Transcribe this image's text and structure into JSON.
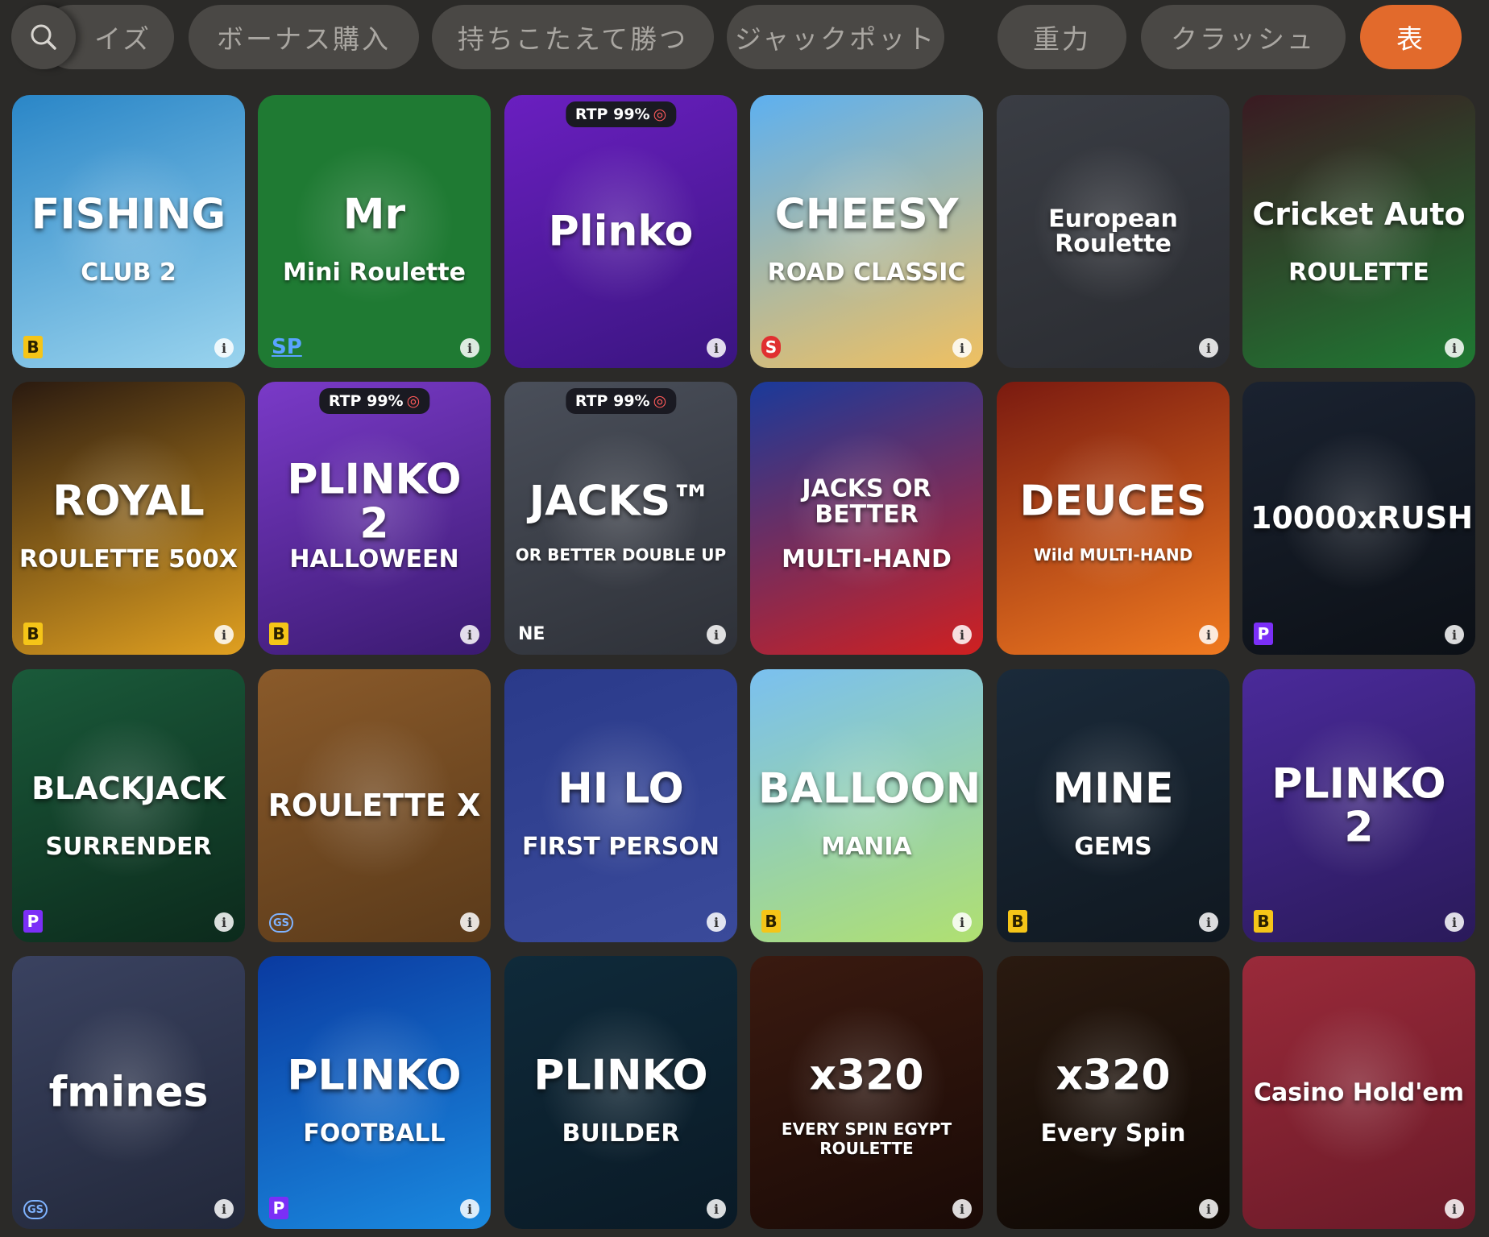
{
  "filters": {
    "search_icon": "search-icon",
    "chips": [
      {
        "label": "イズ",
        "active": false
      },
      {
        "label": "ボーナス購入",
        "active": false
      },
      {
        "label": "持ちこたえて勝つ",
        "active": false
      },
      {
        "label": "ジャックポット",
        "active": false
      },
      {
        "label": "重力",
        "active": false
      },
      {
        "label": "クラッシュ",
        "active": false
      },
      {
        "label": "表",
        "active": true
      }
    ]
  },
  "games": [
    {
      "title": "FISHING",
      "subtitle": "CLUB 2",
      "provider": "B",
      "rtp": "",
      "bg": "#2a86c7",
      "bg2": "#9ad4ee"
    },
    {
      "title": "Mr",
      "subtitle": "Mini Roulette",
      "provider": "SP",
      "rtp": "",
      "bg": "#1f7a33",
      "bg2": "#1f7a33"
    },
    {
      "title": "Plinko",
      "subtitle": "",
      "provider": "",
      "rtp": "RTP 99%",
      "bg": "#6a1fc0",
      "bg2": "#3a1580"
    },
    {
      "title": "CHEESY",
      "subtitle": "ROAD CLASSIC",
      "provider": "S",
      "rtp": "",
      "bg": "#5db0f0",
      "bg2": "#f0c060"
    },
    {
      "title": "European Roulette",
      "subtitle": "",
      "provider": "",
      "rtp": "",
      "bg": "#3a3d44",
      "bg2": "#2a2c31"
    },
    {
      "title": "Cricket Auto",
      "subtitle": "ROULETTE",
      "provider": "",
      "rtp": "",
      "bg": "#3a1a22",
      "bg2": "#1f7a33"
    },
    {
      "title": "ROYAL",
      "subtitle": "ROULETTE 500X",
      "provider": "B",
      "rtp": "",
      "bg": "#2a1a10",
      "bg2": "#e0a020"
    },
    {
      "title": "PLINKO 2",
      "subtitle": "HALLOWEEN",
      "provider": "B",
      "rtp": "RTP 99%",
      "bg": "#7a3ac8",
      "bg2": "#3a1a70"
    },
    {
      "title": "JACKS™",
      "subtitle": "OR BETTER DOUBLE UP",
      "provider": "NE",
      "rtp": "RTP 99%",
      "bg": "#4a4f5a",
      "bg2": "#2e3138"
    },
    {
      "title": "JACKS OR BETTER",
      "subtitle": "MULTI-HAND",
      "provider": "",
      "rtp": "",
      "bg": "#1a3a9a",
      "bg2": "#d02020"
    },
    {
      "title": "DEUCES",
      "subtitle": "Wild MULTI-HAND",
      "provider": "",
      "rtp": "",
      "bg": "#7a1a10",
      "bg2": "#f07a20"
    },
    {
      "title": "10000xRUSH",
      "subtitle": "",
      "provider": "P",
      "rtp": "",
      "bg": "#1a2230",
      "bg2": "#0c1016"
    },
    {
      "title": "BLACKJACK",
      "subtitle": "SURRENDER",
      "provider": "P",
      "rtp": "",
      "bg": "#1a5a3a",
      "bg2": "#0c2a1c"
    },
    {
      "title": "ROULETTE X",
      "subtitle": "",
      "provider": "GS",
      "rtp": "",
      "bg": "#8a5a2a",
      "bg2": "#5a3a1a"
    },
    {
      "title": "HI LO",
      "subtitle": "FIRST PERSON",
      "provider": "",
      "rtp": "",
      "bg": "#2a3a8a",
      "bg2": "#3a4a9a"
    },
    {
      "title": "BALLOON",
      "subtitle": "MANIA",
      "provider": "B",
      "rtp": "",
      "bg": "#7ac0f0",
      "bg2": "#b0e070"
    },
    {
      "title": "MINE",
      "subtitle": "GEMS",
      "provider": "B",
      "rtp": "",
      "bg": "#1a2a3a",
      "bg2": "#101820"
    },
    {
      "title": "PLINKO 2",
      "subtitle": "",
      "provider": "B",
      "rtp": "",
      "bg": "#4a2a9a",
      "bg2": "#2a1a5a"
    },
    {
      "title": "fmines",
      "subtitle": "",
      "provider": "GS",
      "rtp": "",
      "bg": "#3a4260",
      "bg2": "#22283a"
    },
    {
      "title": "PLINKO",
      "subtitle": "FOOTBALL",
      "provider": "P",
      "rtp": "",
      "bg": "#0a3aa0",
      "bg2": "#1a8ae0"
    },
    {
      "title": "PLINKO",
      "subtitle": "BUILDER",
      "provider": "",
      "rtp": "",
      "bg": "#0f2a3a",
      "bg2": "#0a1a26"
    },
    {
      "title": "x320",
      "subtitle": "EVERY SPIN EGYPT ROULETTE",
      "provider": "",
      "rtp": "",
      "bg": "#3a1a10",
      "bg2": "#1a0a06"
    },
    {
      "title": "x320",
      "subtitle": "Every Spin",
      "provider": "",
      "rtp": "",
      "bg": "#2a1a10",
      "bg2": "#0e0804"
    },
    {
      "title": "Casino Hold'em",
      "subtitle": "",
      "provider": "",
      "rtp": "",
      "bg": "#9a2a3a",
      "bg2": "#6a1a28"
    }
  ],
  "info_icon": "info-icon",
  "rtp_icon": "target-icon"
}
